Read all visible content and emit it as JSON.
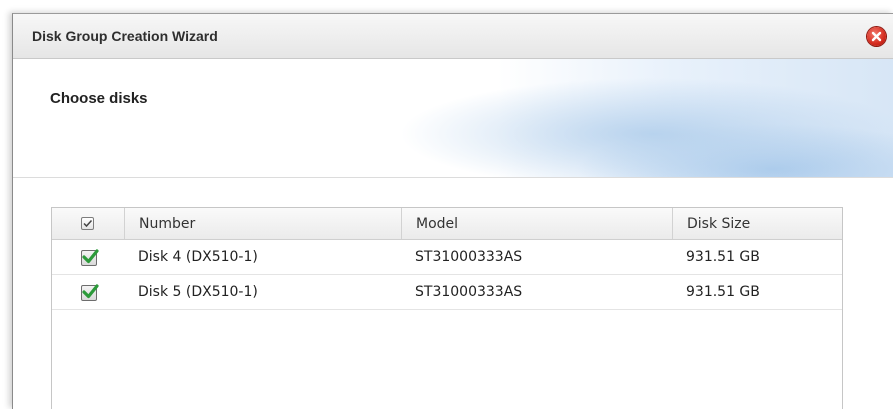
{
  "window": {
    "title": "Disk Group Creation Wizard"
  },
  "header": {
    "page_title": "Choose disks"
  },
  "table": {
    "columns": [
      "Number",
      "Model",
      "Disk Size"
    ],
    "rows": [
      {
        "checked": true,
        "number": "Disk 4 (DX510-1)",
        "model": "ST31000333AS",
        "size": "931.51 GB"
      },
      {
        "checked": true,
        "number": "Disk 5 (DX510-1)",
        "model": "ST31000333AS",
        "size": "931.51 GB"
      }
    ]
  },
  "icons": {
    "close": "close-icon",
    "select_all": "checkbox-checked-icon",
    "row_check": "checkbox-checked-icon"
  },
  "colors": {
    "close_button": "#d42b1e",
    "checkmark": "#2c9a3a"
  }
}
